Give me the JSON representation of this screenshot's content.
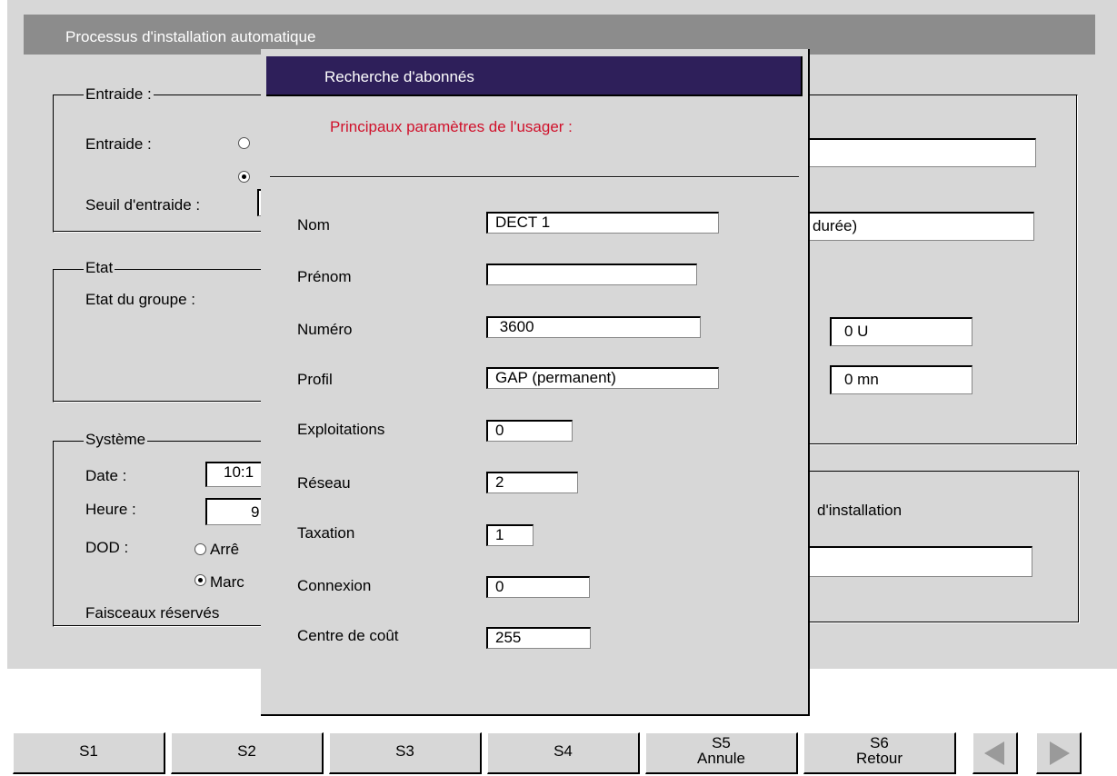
{
  "window": {
    "title": "Processus d'installation automatique"
  },
  "background": {
    "entraide": {
      "group_label": "Entraide :",
      "label": "Entraide :",
      "threshold_label": "Seuil d'entraide :"
    },
    "etat": {
      "group_label": "Etat",
      "group_state_label": "Etat du groupe :"
    },
    "systeme": {
      "group_label": "Système",
      "date_label": "Date :",
      "date_value": "10:1",
      "time_label": "Heure :",
      "time_value": "9",
      "dod_label": "DOD :",
      "dod_off": "Arrê",
      "dod_on": "Marc",
      "reserved_label": "Faisceaux réservés"
    },
    "right": {
      "duration_text": "durée)",
      "units_value": "0  U",
      "minutes_value": "0  mn",
      "install_text": "d'installation"
    }
  },
  "dialog": {
    "title": "Recherche d'abonnés",
    "subtitle": "Principaux paramètres de l'usager :",
    "fields": [
      {
        "label": "Nom",
        "value": "DECT 1"
      },
      {
        "label": "Prénom",
        "value": ""
      },
      {
        "label": "Numéro",
        "value": " 3600"
      },
      {
        "label": "Profil",
        "value": "GAP (permanent)"
      },
      {
        "label": "Exploitations",
        "value": "0"
      },
      {
        "label": "Réseau",
        "value": "2"
      },
      {
        "label": "Taxation",
        "value": "1"
      },
      {
        "label": "Connexion",
        "value": "0"
      },
      {
        "label": "Centre de coût",
        "value": "255"
      }
    ]
  },
  "softkeys": [
    {
      "line1": "S1",
      "line2": ""
    },
    {
      "line1": "S2",
      "line2": ""
    },
    {
      "line1": "S3",
      "line2": ""
    },
    {
      "line1": "S4",
      "line2": ""
    },
    {
      "line1": "S5",
      "line2": "Annule"
    },
    {
      "line1": "S6",
      "line2": "Retour"
    }
  ],
  "nav": {
    "prev_icon": "arrow-left-icon",
    "next_icon": "arrow-right-icon"
  },
  "colors": {
    "panel": "#d7d7d7",
    "titlebar": "#8c8c8c",
    "dialog_title": "#2e1f5a",
    "accent_red": "#d0112b"
  }
}
